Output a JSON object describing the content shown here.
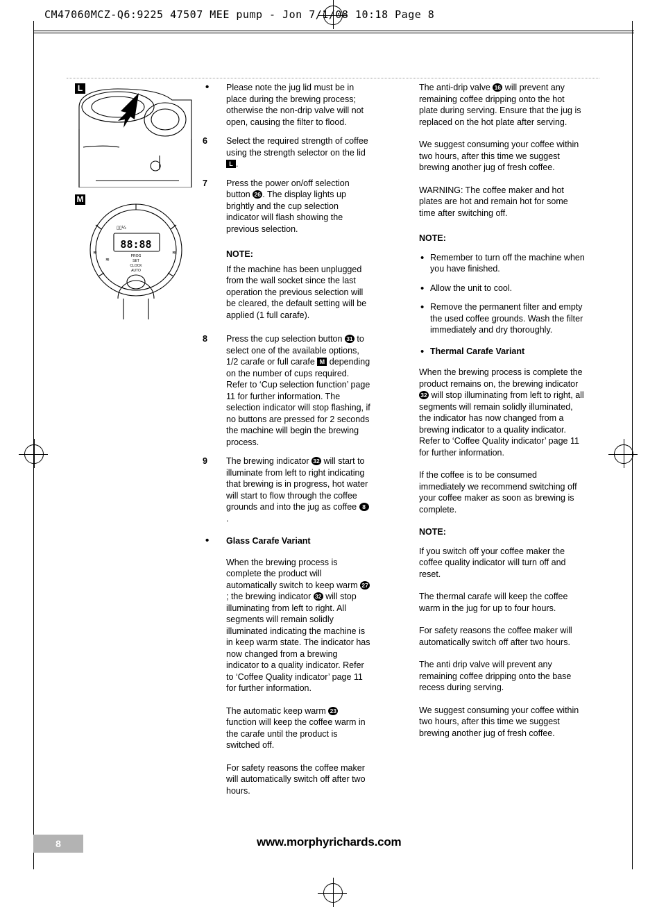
{
  "header": {
    "slug": "CM47060MCZ-Q6:9225 47507 MEE pump - Jon  7/1/08  10:18  Page 8"
  },
  "figures": {
    "label_top": "L",
    "label_bottom": "M"
  },
  "column_b": [
    {
      "marker": "•",
      "marker_type": "bullet",
      "text": "Please note the jug lid must be  in place during the brewing process; otherwise the non-drip valve will not open, causing the filter to flood."
    },
    {
      "marker": "6",
      "marker_type": "number",
      "text_pre": "Select the required strength of coffee using the strength selector on the lid ",
      "ref": "L",
      "ref_type": "square",
      "text_post": "."
    },
    {
      "marker": "7",
      "marker_type": "number",
      "text_pre": "Press the power on/off selection button ",
      "ref": "26",
      "ref_type": "circle",
      "text_post": ". The display lights up brightly and the cup selection indicator will flash showing the previous selection."
    }
  ],
  "column_b_note": {
    "heading": "NOTE:",
    "text": "If the machine has been unplugged from the wall socket since the last operation the previous selection will be cleared, the default setting will be applied (1 full carafe)."
  },
  "column_b_items": [
    {
      "marker": "8",
      "text_1": "Press the cup selection button ",
      "ref_1": "31",
      "text_2": " to select one of the available options, 1/2 carafe or full carafe ",
      "ref_2": "M",
      "text_3": " depending on the number of cups required. Refer to ‘Cup selection function’ page 11 for further information. The selection indicator will stop flashing, if no buttons are pressed for 2 seconds the machine will begin the brewing process."
    },
    {
      "marker": "9",
      "text_1": "The brewing indicator ",
      "ref_1": "32",
      "text_2": " will start to illuminate from left to right indicating that brewing is in progress, hot water will start to flow through the coffee grounds and into the jug as coffee ",
      "ref_2": "8",
      "text_3": "."
    }
  ],
  "glass_carafe": {
    "heading": "Glass Carafe Variant",
    "para1_pre": "When the brewing process is complete the product will automatically switch to keep warm ",
    "para1_ref1": "27",
    "para1_mid": "; the brewing indicator ",
    "para1_ref2": "32",
    "para1_post": " will stop illuminating from left to right. All segments will remain solidly illuminated indicating the machine is in keep warm state. The indicator has now changed from a brewing indicator to a quality indicator. Refer to ‘Coffee Quality indicator’ page 11 for further information.",
    "para2_pre": "The automatic keep warm ",
    "para2_ref": "23",
    "para2_post": " function will keep the coffee warm in the carafe until the product is switched off.",
    "para3": "For safety reasons the coffee maker will automatically switch off after two hours."
  },
  "column_c": {
    "para1_pre": "The anti-drip valve ",
    "para1_ref": "16",
    "para1_post": " will prevent any remaining coffee dripping onto the hot plate during serving. Ensure that the jug is replaced on the hot plate after serving.",
    "para2": "We suggest consuming your coffee within two hours, after this time we suggest brewing another jug of fresh coffee.",
    "para3": "WARNING: The coffee maker and hot plates are hot and remain hot for some time after switching off.",
    "note_heading": "NOTE:",
    "bullets": [
      "Remember to turn off the machine when you have finished.",
      "Allow the unit to cool.",
      "Remove the permanent filter and empty the used coffee grounds. Wash the filter immediately and dry thoroughly."
    ],
    "thermal_heading": "Thermal Carafe Variant",
    "thermal_para1_pre": "When the brewing process is complete the product remains on, the brewing indicator ",
    "thermal_para1_ref": "32",
    "thermal_para1_post": " will stop illuminating from left to right, all segments will remain solidly illuminated, the indicator has now changed from a brewing indicator to a quality indicator. Refer to ‘Coffee Quality indicator’ page 11 for further information.",
    "thermal_para2": "If the coffee is to be consumed immediately we recommend switching off your coffee maker as soon as brewing is complete.",
    "note2_heading": "NOTE:",
    "note2_text": "If you switch off your coffee maker the coffee quality indicator will turn off and reset.",
    "thermal_para3": "The thermal carafe will keep the coffee warm in the jug for up to four hours.",
    "thermal_para4": "For safety reasons the coffee maker will automatically switch off after two hours.",
    "thermal_para5": "The anti drip valve will prevent any remaining coffee dripping onto the base recess during serving.",
    "thermal_para6": "We suggest consuming your coffee within two hours, after this time we suggest brewing another jug of fresh coffee."
  },
  "footer": {
    "page_number": "8",
    "website": "www.morphyrichards.com"
  },
  "display_panel": {
    "time": "88:88",
    "labels": [
      "PROG",
      "SET",
      "CLOCK",
      "AUTO"
    ]
  }
}
